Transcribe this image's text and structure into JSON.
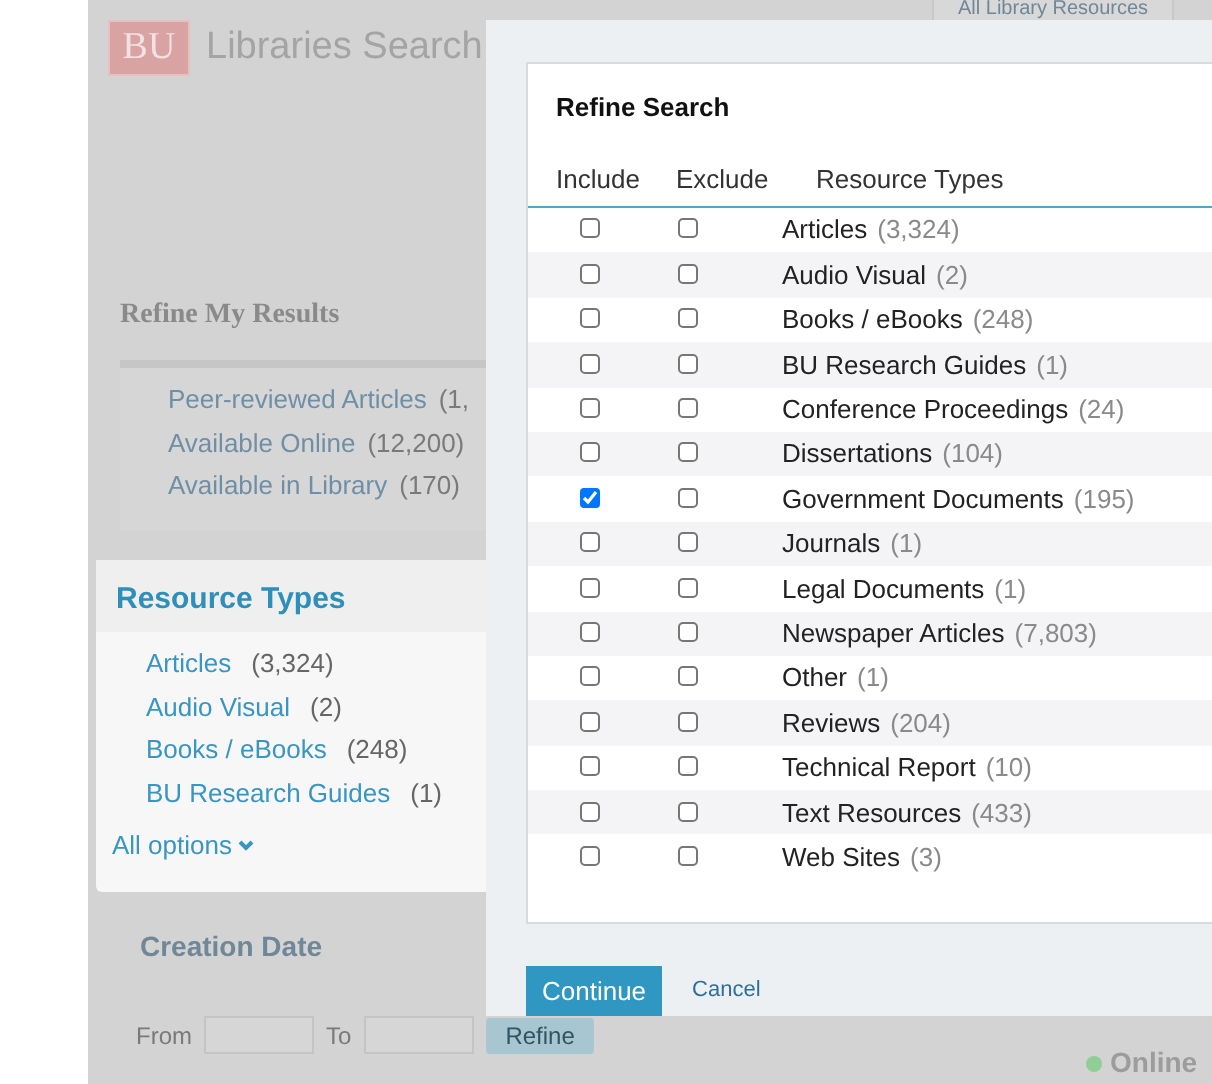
{
  "header": {
    "logo": "BU",
    "title": "Libraries Search",
    "nav_tab": "All Library Resources"
  },
  "sidebar": {
    "heading": "Refine My Results",
    "availability": [
      {
        "label": "Peer-reviewed Articles",
        "count": "(1,"
      },
      {
        "label": "Available Online",
        "count": "(12,200)"
      },
      {
        "label": "Available in Library",
        "count": "(170)"
      }
    ],
    "resource_types": {
      "heading": "Resource Types",
      "items": [
        {
          "label": "Articles",
          "count": "(3,324)"
        },
        {
          "label": "Audio Visual",
          "count": "(2)"
        },
        {
          "label": "Books / eBooks",
          "count": "(248)"
        },
        {
          "label": "BU Research Guides",
          "count": "(1)"
        }
      ],
      "more": "All options"
    },
    "creation_date": {
      "heading": "Creation Date",
      "from_label": "From",
      "to_label": "To",
      "button": "Refine"
    }
  },
  "status": {
    "label": "Online"
  },
  "dialog": {
    "title": "Refine Search",
    "columns": [
      "Include",
      "Exclude",
      "Resource Types"
    ],
    "rows": [
      {
        "label": "Articles",
        "count": "(3,324)",
        "include": false,
        "exclude": false
      },
      {
        "label": "Audio Visual",
        "count": "(2)",
        "include": false,
        "exclude": false
      },
      {
        "label": "Books / eBooks",
        "count": "(248)",
        "include": false,
        "exclude": false
      },
      {
        "label": "BU Research Guides",
        "count": "(1)",
        "include": false,
        "exclude": false
      },
      {
        "label": "Conference Proceedings",
        "count": "(24)",
        "include": false,
        "exclude": false
      },
      {
        "label": "Dissertations",
        "count": "(104)",
        "include": false,
        "exclude": false
      },
      {
        "label": "Government Documents",
        "count": "(195)",
        "include": true,
        "exclude": false
      },
      {
        "label": "Journals",
        "count": "(1)",
        "include": false,
        "exclude": false
      },
      {
        "label": "Legal Documents",
        "count": "(1)",
        "include": false,
        "exclude": false
      },
      {
        "label": "Newspaper Articles",
        "count": "(7,803)",
        "include": false,
        "exclude": false
      },
      {
        "label": "Other",
        "count": "(1)",
        "include": false,
        "exclude": false
      },
      {
        "label": "Reviews",
        "count": "(204)",
        "include": false,
        "exclude": false
      },
      {
        "label": "Technical Report",
        "count": "(10)",
        "include": false,
        "exclude": false
      },
      {
        "label": "Text Resources",
        "count": "(433)",
        "include": false,
        "exclude": false
      },
      {
        "label": "Web Sites",
        "count": "(3)",
        "include": false,
        "exclude": false
      }
    ],
    "buttons": [
      {
        "label": "Continue",
        "kind": "primary"
      },
      {
        "label": "Cancel",
        "kind": "link"
      }
    ]
  }
}
